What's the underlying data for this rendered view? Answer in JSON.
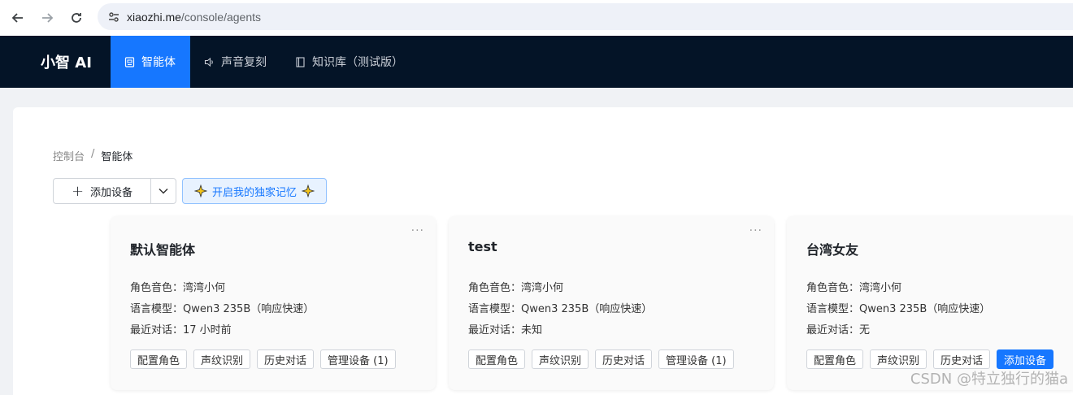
{
  "browser": {
    "url_host": "xiaozhi.me",
    "url_path": "/console/agents"
  },
  "header": {
    "logo": "小智 AI",
    "nav": [
      {
        "label": "智能体",
        "active": true
      },
      {
        "label": "声音复刻",
        "active": false
      },
      {
        "label": "知识库（测试版）",
        "active": false
      }
    ]
  },
  "breadcrumb": {
    "root": "控制台",
    "separator": "/",
    "current": "智能体"
  },
  "toolbar": {
    "add_device": "添加设备",
    "memory": "开启我的独家记忆"
  },
  "cards": [
    {
      "title": "默认智能体",
      "voice": "角色音色：湾湾小何",
      "model": "语言模型：Qwen3 235B（响应快速）",
      "last_chat": "最近对话：17 小时前",
      "actions": [
        "配置角色",
        "声纹识别",
        "历史对话",
        "管理设备 (1)"
      ]
    },
    {
      "title": "test",
      "voice": "角色音色：湾湾小何",
      "model": "语言模型：Qwen3 235B（响应快速）",
      "last_chat": "最近对话：未知",
      "actions": [
        "配置角色",
        "声纹识别",
        "历史对话",
        "管理设备 (1)"
      ]
    },
    {
      "title": "台湾女友",
      "voice": "角色音色：湾湾小何",
      "model": "语言模型：Qwen3 235B（响应快速）",
      "last_chat": "最近对话：无",
      "actions": [
        "配置角色",
        "声纹识别",
        "历史对话",
        "添加设备"
      ]
    }
  ],
  "watermark": "CSDN @特立独行的猫a",
  "colors": {
    "header_bg": "#041427",
    "accent": "#1677ff",
    "memory_bg": "#e8f2ff"
  }
}
